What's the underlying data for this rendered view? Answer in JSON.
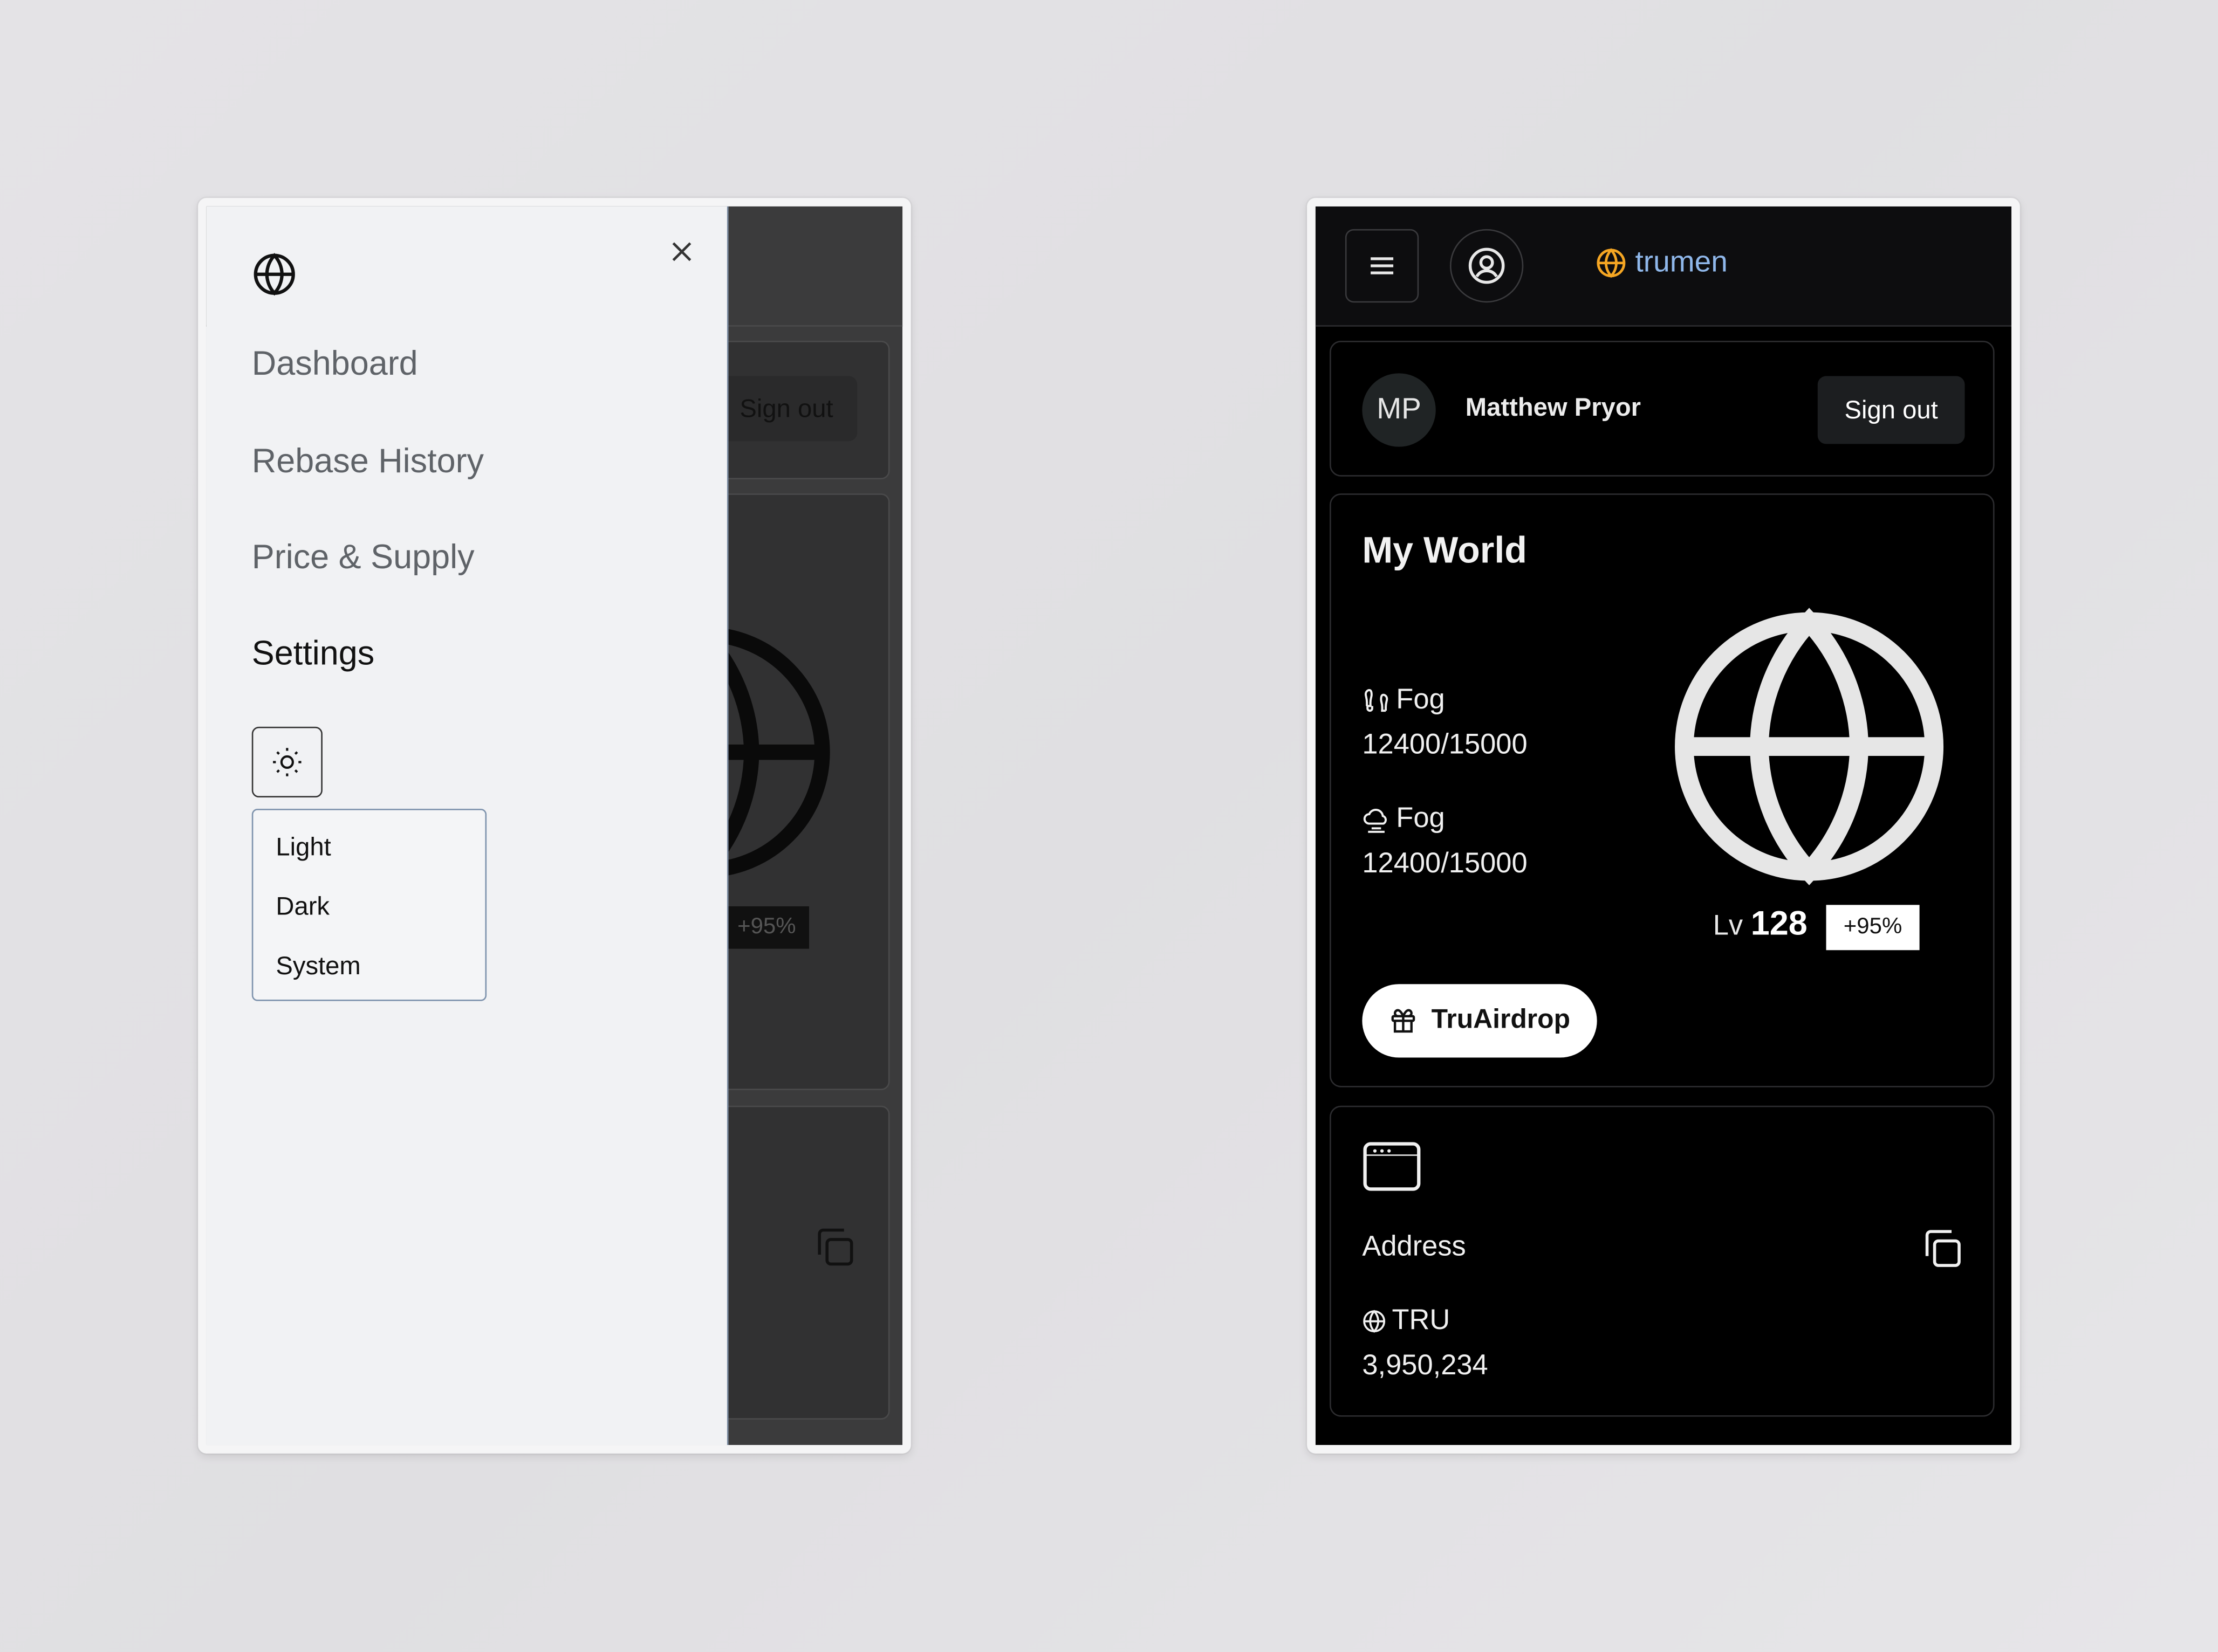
{
  "nav_drawer": {
    "items": [
      {
        "label": "Dashboard",
        "active": false
      },
      {
        "label": "Rebase History",
        "active": false
      },
      {
        "label": "Price & Supply",
        "active": false
      },
      {
        "label": "Settings",
        "active": true
      }
    ],
    "theme_options": [
      "Light",
      "Dark",
      "System"
    ],
    "icons": {
      "logo": "globe-icon",
      "close": "close-icon",
      "theme": "sun-icon"
    }
  },
  "background_app": {
    "sign_out_label": "Sign out",
    "level_badge": "+95%"
  },
  "header": {
    "brand_name": "trumen",
    "brand_color": "#f5a623",
    "brand_text_color": "#8fb7ea",
    "icons": {
      "menu": "hamburger-icon",
      "profile": "user-circle-icon",
      "brand": "globe-icon"
    }
  },
  "user_card": {
    "initials": "MP",
    "name": "Matthew Pryor",
    "sign_out_label": "Sign out"
  },
  "world_card": {
    "title": "My World",
    "stats": [
      {
        "icon": "footprints-icon",
        "label": "Fog",
        "value": "12400/15000"
      },
      {
        "icon": "cloud-fog-icon",
        "label": "Fog",
        "value": "12400/15000"
      }
    ],
    "level_prefix": "Lv",
    "level": "128",
    "level_badge": "+95%",
    "airdrop_label": "TruAirdrop",
    "airdrop_icon": "gift-icon"
  },
  "address_card": {
    "icon": "browser-window-icon",
    "label": "Address",
    "copy_icon": "copy-icon",
    "token_label": "TRU",
    "token_value": "3,950,234"
  }
}
